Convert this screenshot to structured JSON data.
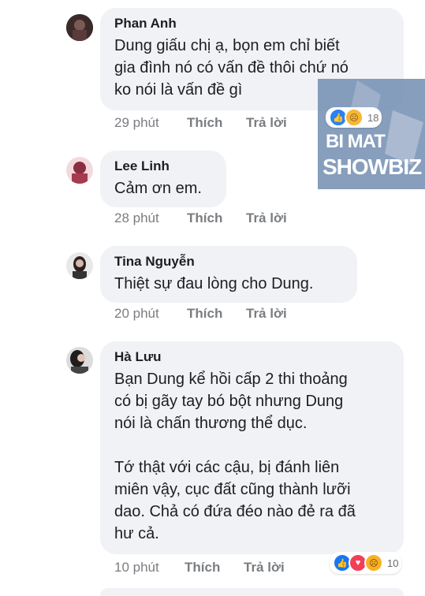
{
  "comments": [
    {
      "author": "Phan Anh",
      "text": "Dung giấu chị ạ, bọn em chỉ biết\ngia đình nó có vấn đề thôi chứ nó\nko nói là vấn đề gì",
      "time": "29 phút",
      "like_label": "Thích",
      "reply_label": "Trả lời",
      "reaction_count": "18"
    },
    {
      "author": "Lee Linh",
      "text": "Cảm ơn em.",
      "time": "28 phút",
      "like_label": "Thích",
      "reply_label": "Trả lời"
    },
    {
      "author": "Tina Nguyễn",
      "text": "Thiệt sự đau lòng cho Dung.",
      "time": "20 phút",
      "like_label": "Thích",
      "reply_label": "Trả lời"
    },
    {
      "author": "Hà Lưu",
      "text": "Bạn Dung kể hồi cấp 2 thi thoảng\ncó bị gãy tay bó bột nhưng Dung\nnói là chấn thương thể dục.\n\nTớ thật với các cậu, bị đánh liên\nmiên vậy, cục đất cũng thành lưỡi\ndao. Chả có đứa đéo nào đẻ ra đã\như cả.",
      "time": "10 phút",
      "like_label": "Thích",
      "reply_label": "Trả lời",
      "reaction_count": "10"
    }
  ],
  "watermark": {
    "line1": "BI MAT",
    "line2": "SHOWBIZ"
  },
  "colors": {
    "bubble": "#f0f2f5",
    "meta": "#7a7d81",
    "like": "#1877f2",
    "love": "#f33e58",
    "sad": "#f7b125"
  }
}
